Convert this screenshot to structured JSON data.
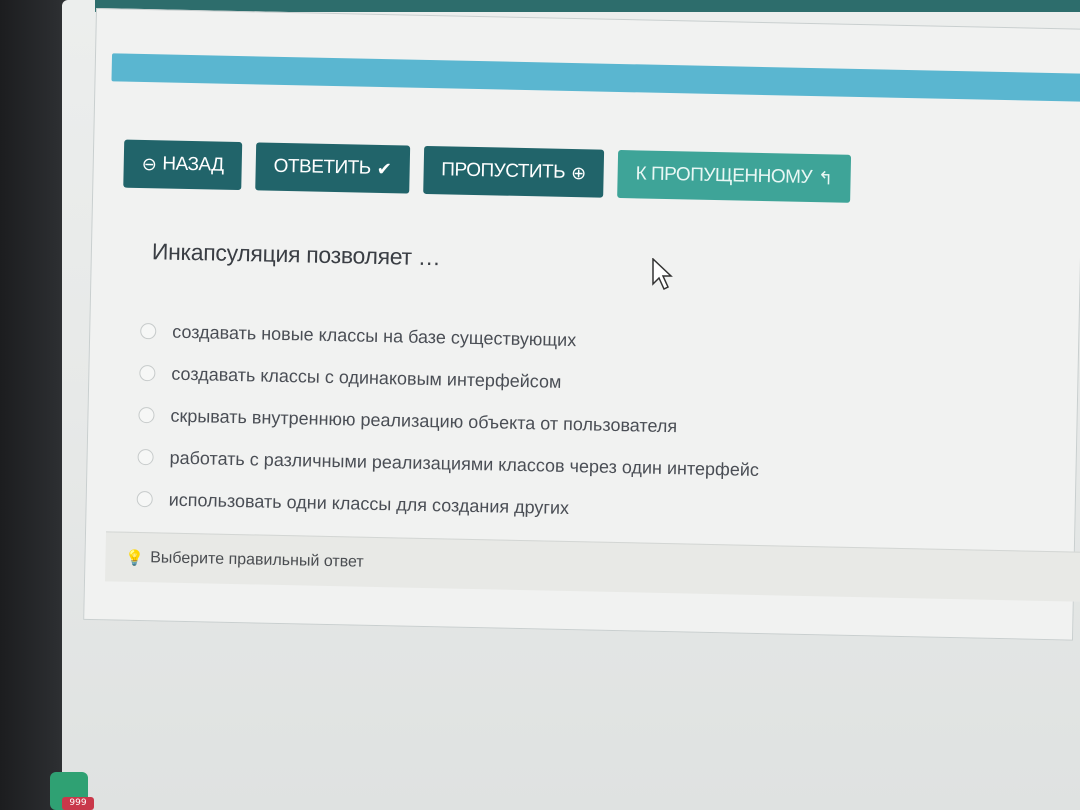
{
  "toolbar": {
    "back_label": "НАЗАД",
    "answer_label": "ОТВЕТИТЬ",
    "skip_label": "ПРОПУСТИТЬ",
    "to_skipped_label": "К ПРОПУЩЕННОМУ"
  },
  "question": {
    "text": "Инкапсуляция позволяет …",
    "options": [
      {
        "label": "создавать новые классы на базе существующих"
      },
      {
        "label": "создавать классы с одинаковым интерфейсом"
      },
      {
        "label": "скрывать внутреннюю реализацию объекта от пользователя"
      },
      {
        "label": "работать с различными реализациями классов через один интерфейс"
      },
      {
        "label": "использовать одни классы для создания других"
      }
    ]
  },
  "hint": {
    "text": "Выберите правильный ответ"
  },
  "taskbar": {
    "badge": "999"
  },
  "colors": {
    "primary": "#21646a",
    "secondary": "#3ea498",
    "progress": "#5ab6d0"
  }
}
